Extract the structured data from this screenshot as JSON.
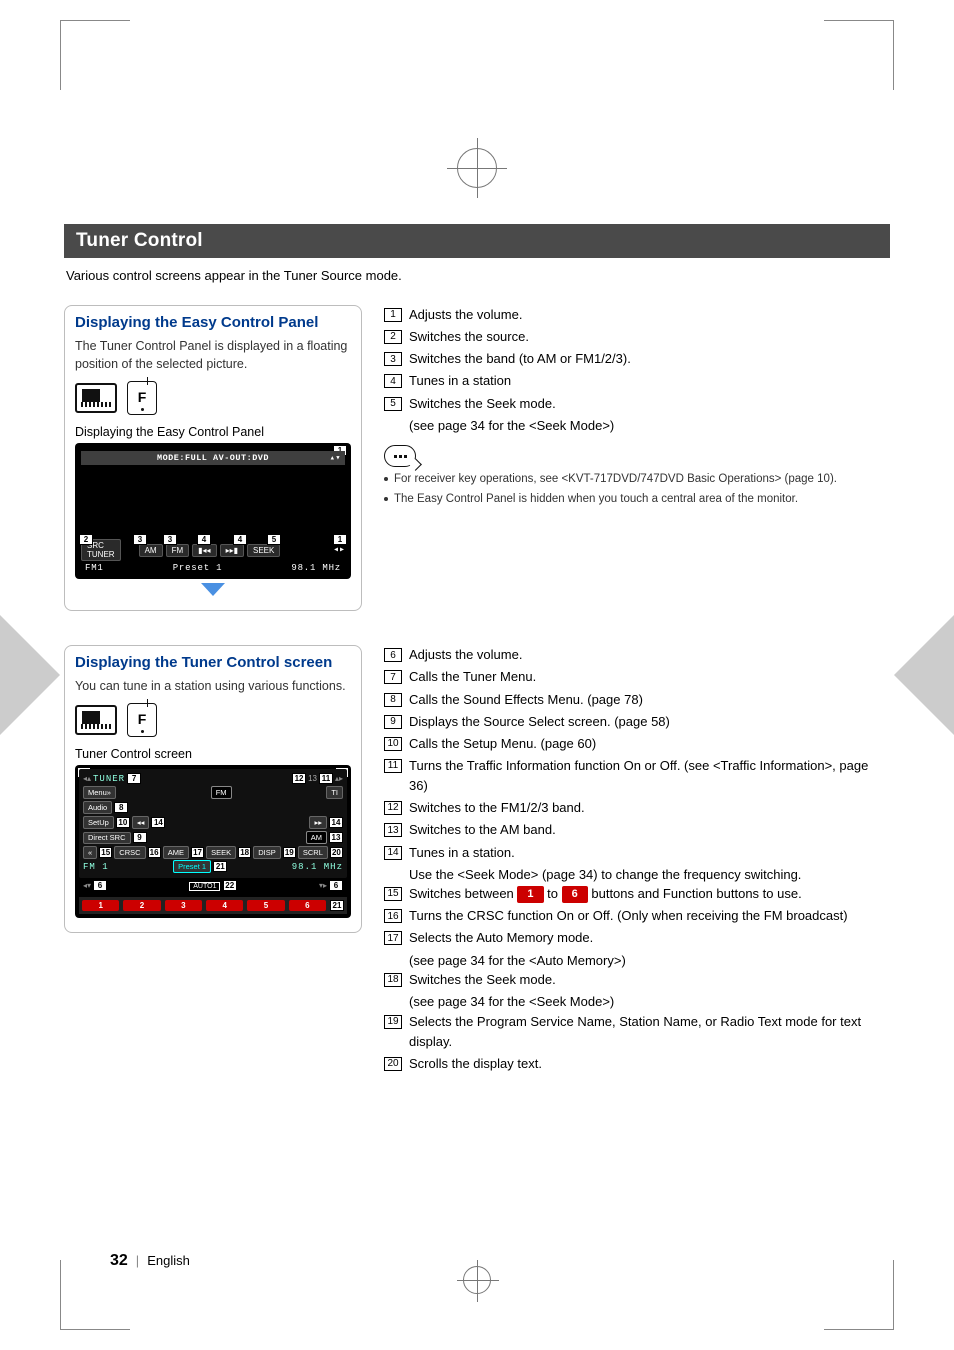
{
  "page": {
    "number": "32",
    "language": "English"
  },
  "header": {
    "title": "Tuner Control",
    "intro": "Various control screens appear in the Tuner Source mode."
  },
  "easy_panel": {
    "heading": "Displaying the Easy Control Panel",
    "desc": "The Tuner Control Panel is displayed in a floating position of the selected picture.",
    "caption": "Displaying the Easy Control Panel",
    "topbar": "MODE:FULL  AV-OUT:DVD",
    "src_label": "SRC",
    "tuner_label": "TUNER",
    "btn_am": "AM",
    "btn_fm": "FM",
    "btn_prev": "▮◂◂",
    "btn_next": "▸▸▮",
    "btn_seek": "SEEK",
    "fm1": "FM1",
    "preset": "Preset 1",
    "freq": "98.1 MHz",
    "f_key": "F"
  },
  "easy_list": {
    "items": [
      {
        "n": "1",
        "t": "Adjusts the volume."
      },
      {
        "n": "2",
        "t": "Switches the source."
      },
      {
        "n": "3",
        "t": "Switches the band (to AM or FM1/2/3)."
      },
      {
        "n": "4",
        "t": "Tunes in a station"
      },
      {
        "n": "5",
        "t": "Switches the Seek mode."
      }
    ],
    "sub5": "(see page 34 for the <Seek Mode>)",
    "notes": [
      "For receiver key operations, see <KVT-717DVD/747DVD Basic Operations> (page 10).",
      "The Easy Control Panel is hidden when you touch a central area of the monitor."
    ]
  },
  "tuner_panel": {
    "heading": "Displaying the Tuner Control screen",
    "desc": "You can tune in a station using various functions.",
    "caption": "Tuner Control screen",
    "tuner_title": "TUNER",
    "menu": "Menu»",
    "audio": "Audio",
    "setup": "SetUp",
    "direct": "Direct SRC",
    "fm_label": "FM",
    "ti_label": "TI",
    "am_label": "AM",
    "crsc": "CRSC",
    "ame": "AME",
    "seek": "SEEK",
    "disp": "DISP",
    "scrl": "SCRL",
    "arrow": "«",
    "fm1": "FM 1",
    "preset_box": "Preset 1",
    "freq": "98.1 MHz",
    "auto": "AUTO1",
    "presets": [
      "1",
      "2",
      "3",
      "4",
      "5",
      "6"
    ]
  },
  "tuner_list": {
    "items": [
      {
        "n": "6",
        "t": "Adjusts the volume."
      },
      {
        "n": "7",
        "t": "Calls the Tuner Menu."
      },
      {
        "n": "8",
        "t": "Calls the Sound Effects Menu. (page 78)"
      },
      {
        "n": "9",
        "t": "Displays the Source Select screen. (page 58)"
      },
      {
        "n": "10",
        "t": "Calls the Setup Menu. (page 60)"
      },
      {
        "n": "11",
        "t": "Turns the Traffic Information function On or Off. (see <Traffic Information>, page 36)"
      },
      {
        "n": "12",
        "t": "Switches to the FM1/2/3 band."
      },
      {
        "n": "13",
        "t": "Switches to the AM band."
      },
      {
        "n": "14",
        "t": "Tunes in a station."
      }
    ],
    "sub14a": "Use the <Seek Mode> (page 34) to change the frequency switching.",
    "item15_pre": "Switches between ",
    "item15_mid": " to ",
    "item15_post": " buttons and Function buttons to use.",
    "preset1": "1",
    "preset6": "6",
    "items2": [
      {
        "n": "16",
        "t": "Turns the CRSC function On or Off. (Only when receiving the FM broadcast)"
      },
      {
        "n": "17",
        "t": "Selects the Auto Memory mode."
      }
    ],
    "sub17": "(see page 34 for the <Auto Memory>)",
    "items3": [
      {
        "n": "18",
        "t": "Switches the Seek mode."
      }
    ],
    "sub18": "(see page 34 for the <Seek Mode>)",
    "items4": [
      {
        "n": "19",
        "t": "Selects the Program Service Name, Station Name, or Radio Text mode for text display."
      },
      {
        "n": "20",
        "t": "Scrolls the display text."
      }
    ]
  }
}
